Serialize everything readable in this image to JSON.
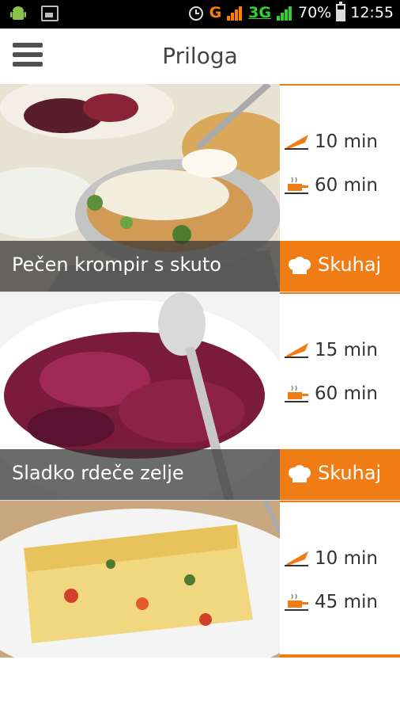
{
  "status_bar": {
    "network_g": "G",
    "network_3g": "3G",
    "battery": "70%",
    "time": "12:55"
  },
  "header": {
    "title": "Priloga"
  },
  "recipes": [
    {
      "name": "Pečen krompir s skuto",
      "prep_time": "10 min",
      "cook_time": "60 min",
      "button": "Skuhaj"
    },
    {
      "name": "Sladko rdeče zelje",
      "prep_time": "15 min",
      "cook_time": "60 min",
      "button": "Skuhaj"
    },
    {
      "name": "",
      "prep_time": "10 min",
      "cook_time": "45 min",
      "button": ""
    }
  ],
  "colors": {
    "accent": "#f07c16",
    "overlay": "#323232",
    "title": "#444444"
  },
  "icons": {
    "prep": "knife-icon",
    "cook": "pot-icon",
    "cook_button": "chef-hat-icon",
    "menu": "hamburger-menu-icon"
  }
}
